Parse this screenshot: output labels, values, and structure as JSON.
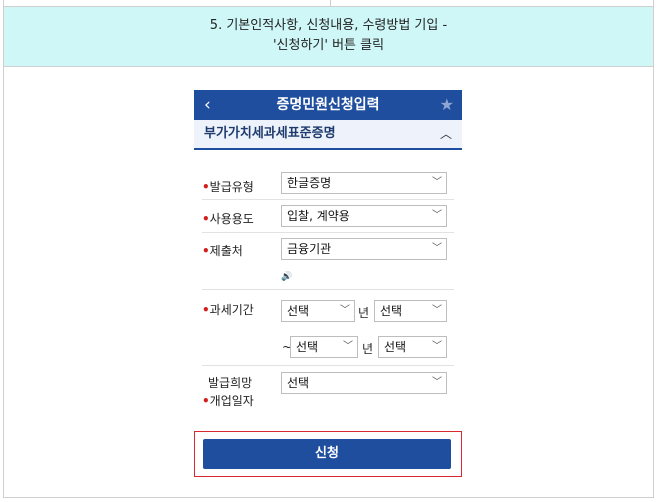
{
  "caption": {
    "line1": "5. 기본인적사항, 신청내용, 수령방법 기입 -",
    "line2": "'신청하기' 버튼 클릭"
  },
  "appbar": {
    "back": "‹",
    "title": "증명민원신청입력",
    "star": "★"
  },
  "section": {
    "title": "부가가치세과세표준증명",
    "chevron": "︿"
  },
  "form": {
    "req_mark": "•",
    "issue_type": {
      "label": "발급유형",
      "value": "한글증명"
    },
    "usage": {
      "label": "사용용도",
      "value": "입찰, 계약용"
    },
    "submit_to": {
      "label": "제출처",
      "value": "금융기관"
    },
    "speaker_icon": "🔊",
    "tax_period": {
      "label": "과세기간",
      "from_year": "선택",
      "from_unit": "년",
      "from_term": "선택",
      "tilde": "~",
      "to_year": "선택",
      "to_unit": "년",
      "to_term": "선택"
    },
    "open_date": {
      "label_line1": "발급희망",
      "label_line2": "개업일자",
      "value": "선택"
    }
  },
  "submit_label": "신청"
}
